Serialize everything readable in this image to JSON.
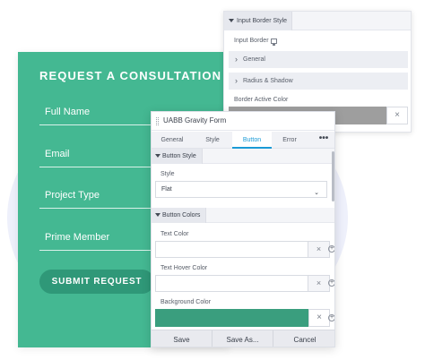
{
  "form": {
    "title": "REQUEST A CONSULTATION",
    "fields": [
      "Full Name",
      "Email",
      "Project Type",
      "Prime Member"
    ],
    "submit_label": "SUBMIT REQUEST",
    "bg_color": "#44b892",
    "button_color": "#2f9878"
  },
  "top_panel": {
    "section_title": "Input Border Style",
    "input_border_label": "Input Border",
    "rows": [
      "General",
      "Radius & Shadow"
    ],
    "border_active_color_label": "Border Active Color",
    "border_active_color": "#9e9e9e",
    "clear_icon": "×"
  },
  "main_panel": {
    "title": "UABB Gravity Form",
    "tabs": [
      "General",
      "Style",
      "Button",
      "Error"
    ],
    "active_tab": "Button",
    "more_icon": "•••",
    "button_style_section": "Button Style",
    "style_label": "Style",
    "style_value": "Flat",
    "button_colors_section": "Button Colors",
    "text_color_label": "Text Color",
    "text_hover_color_label": "Text Hover Color",
    "background_color_label": "Background Color",
    "background_color": "#3a9e7e",
    "clear_icon": "×",
    "add_icon": "+",
    "footer": {
      "save": "Save",
      "save_as": "Save As...",
      "cancel": "Cancel"
    }
  }
}
